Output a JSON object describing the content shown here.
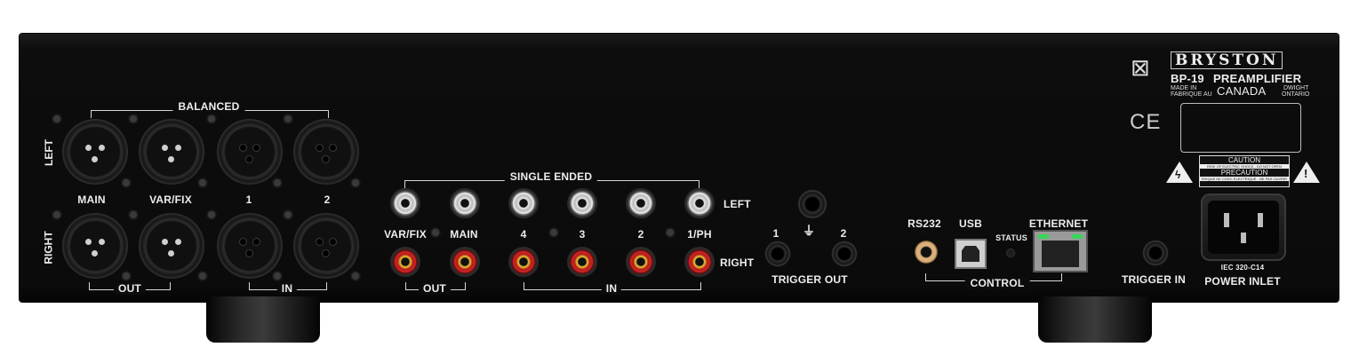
{
  "brand": {
    "logo_text": "BRYSTON",
    "model": "BP-19",
    "product": "PREAMPLIFIER",
    "made_in": "MADE IN",
    "fabrique": "FABRIQUE AU",
    "country": "CANADA",
    "city": "DWIGHT",
    "province": "ONTARIO"
  },
  "balanced": {
    "title": "BALANCED",
    "left": "LEFT",
    "right": "RIGHT",
    "labels": [
      "MAIN",
      "VAR/FIX",
      "1",
      "2"
    ],
    "out": "OUT",
    "in": "IN"
  },
  "single_ended": {
    "title": "SINGLE ENDED",
    "labels": [
      "VAR/FIX",
      "MAIN",
      "4",
      "3",
      "2",
      "1/PH"
    ],
    "left": "LEFT",
    "right": "RIGHT",
    "out": "OUT",
    "in": "IN"
  },
  "trigger_out": {
    "title": "TRIGGER OUT",
    "labels": [
      "1",
      "2"
    ]
  },
  "control": {
    "title": "CONTROL",
    "rs232": "RS232",
    "usb": "USB",
    "status": "STATUS",
    "ethernet": "ETHERNET"
  },
  "trigger_in": "TRIGGER IN",
  "power": {
    "spec": "IEC 320-C14",
    "title": "POWER INLET"
  },
  "caution": {
    "title": "CAUTION",
    "line1": "RISK OF ELECTRIC SHOCK - DO NOT OPEN",
    "precaution": "PRECAUTION",
    "line2": "RISQUE DE CHOC ELECTRIQUE - NE PAS OUVRIR"
  },
  "ce": "CE"
}
